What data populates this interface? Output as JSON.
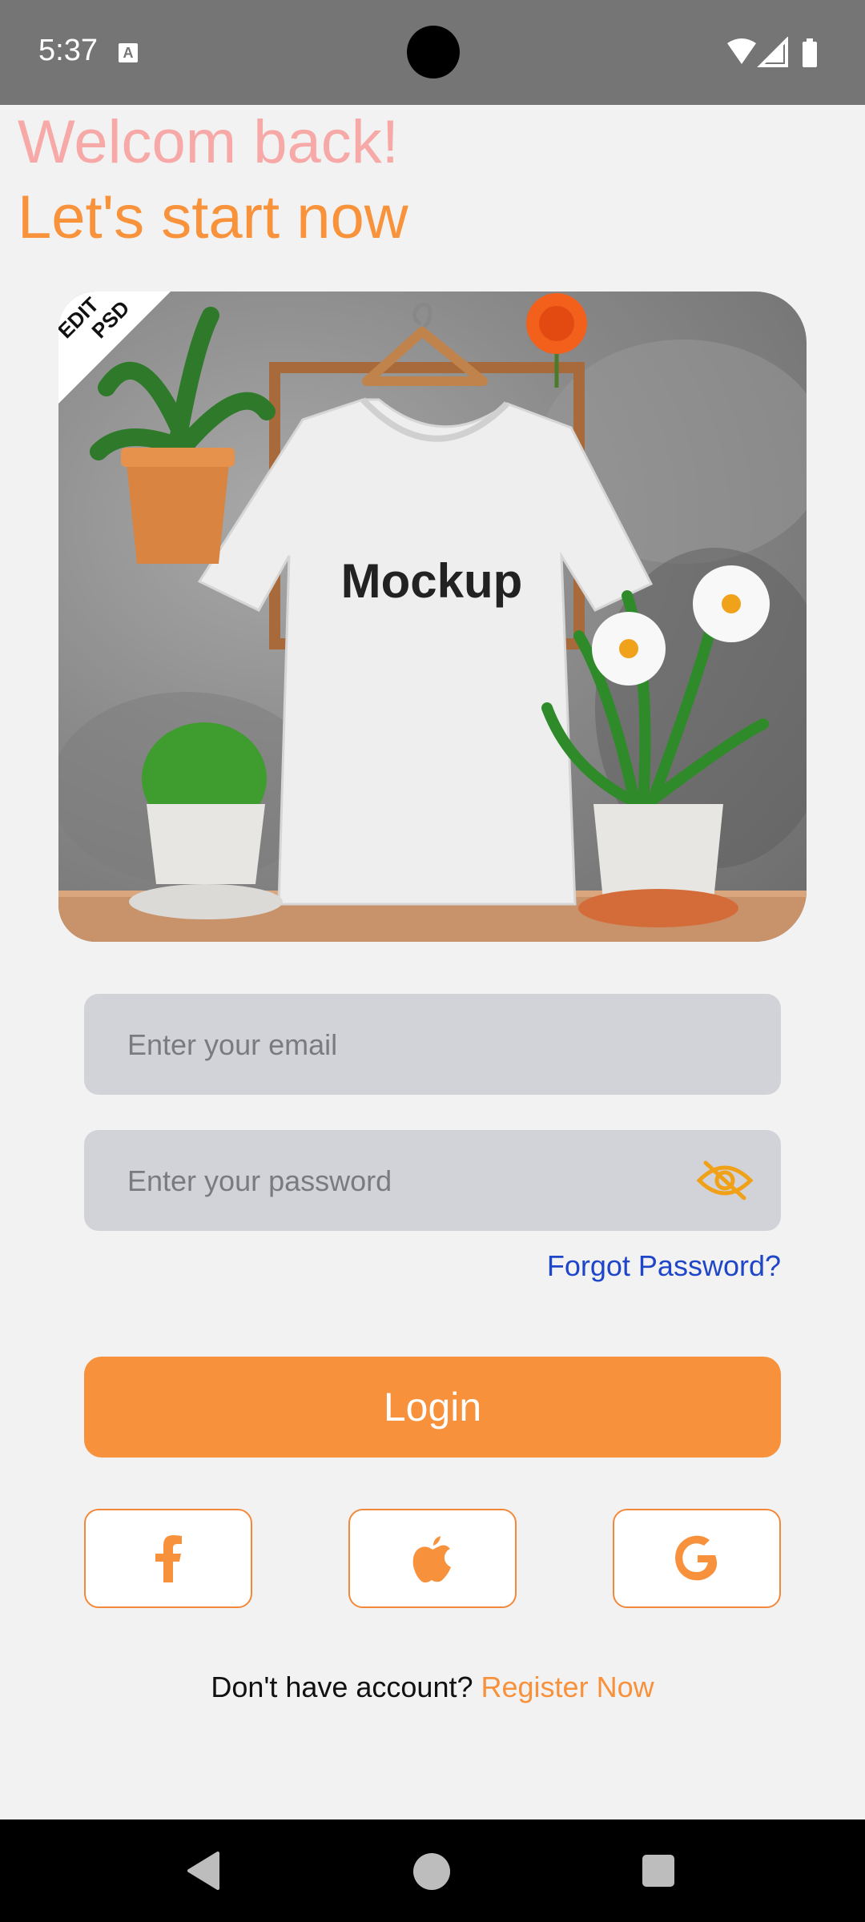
{
  "status_bar": {
    "time": "5:37",
    "notification_icon": "A"
  },
  "header": {
    "welcome": "Welcom back!",
    "subtitle": "Let's start now"
  },
  "hero": {
    "shirt_text": "Mockup",
    "corner_badge_line1": "EDIT",
    "corner_badge_line2": "PSD"
  },
  "form": {
    "email_placeholder": "Enter your email",
    "email_value": "",
    "password_placeholder": "Enter your password",
    "password_value": "",
    "forgot_label": "Forgot Password?",
    "login_label": "Login"
  },
  "social": [
    {
      "icon": "facebook-icon"
    },
    {
      "icon": "apple-icon"
    },
    {
      "icon": "google-icon"
    }
  ],
  "footer": {
    "prompt": "Don't have account?",
    "register_label": "Register Now"
  },
  "colors": {
    "accent": "#f8913b",
    "welcome": "#f7a9a8",
    "link": "#1f46c8",
    "field_bg": "#d2d3d9"
  }
}
